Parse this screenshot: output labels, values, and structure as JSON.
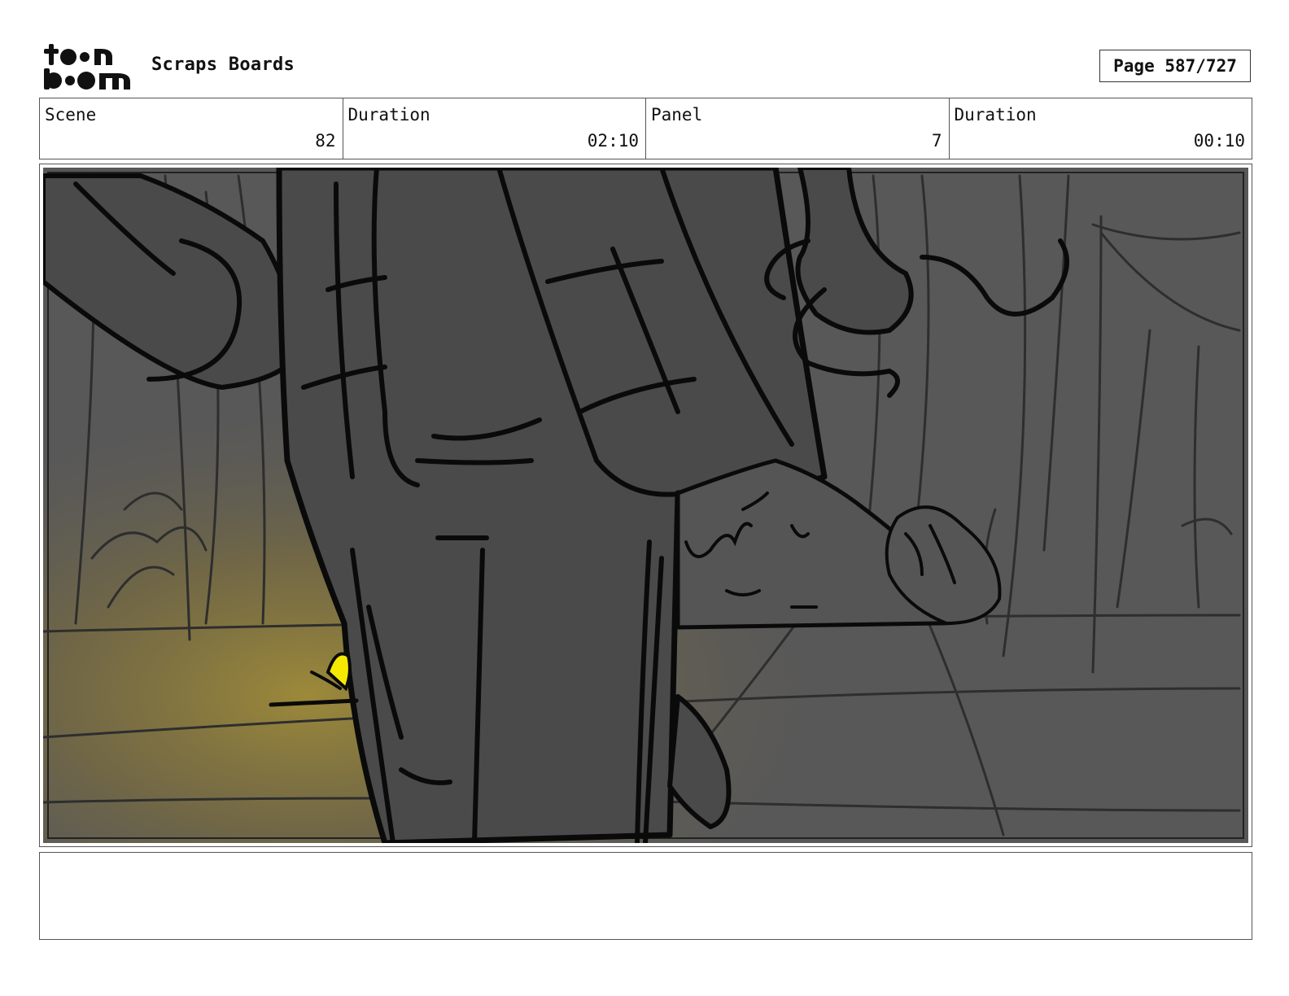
{
  "header": {
    "logo_text_top": "toon",
    "logo_text_bottom": "boom",
    "title": "Scraps Boards",
    "page_label": "Page 587/727"
  },
  "info": {
    "scene_label": "Scene",
    "scene_value": "82",
    "scene_duration_label": "Duration",
    "scene_duration_value": "02:10",
    "panel_label": "Panel",
    "panel_value": "7",
    "panel_duration_label": "Duration",
    "panel_duration_value": "00:10"
  },
  "panel": {
    "palette": {
      "background": "#585858",
      "figure": "#4a4a4a",
      "ink": "#0a0a0a",
      "glow": "#9c8a3a",
      "highlight": "#f5e900"
    }
  },
  "notes": {
    "text": ""
  }
}
